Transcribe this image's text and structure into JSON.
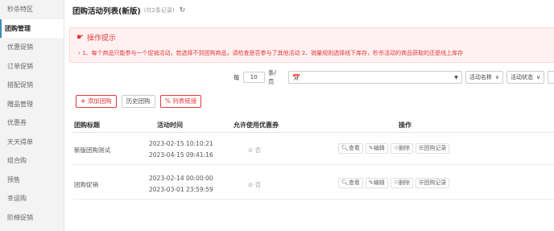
{
  "sidebar": {
    "items": [
      {
        "label": "秒杀特区",
        "active": false
      },
      {
        "label": "团购管理",
        "active": true
      },
      {
        "label": "优惠促销",
        "active": false
      },
      {
        "label": "订单促销",
        "active": false
      },
      {
        "label": "搭配促销",
        "active": false
      },
      {
        "label": "赠品管理",
        "active": false
      },
      {
        "label": "优惠券",
        "active": false
      },
      {
        "label": "天天得单",
        "active": false
      },
      {
        "label": "组合购",
        "active": false
      },
      {
        "label": "预售",
        "active": false
      },
      {
        "label": "幸运购",
        "active": false
      },
      {
        "label": "阶梯促销",
        "active": false
      }
    ]
  },
  "header": {
    "title": "团购活动列表(新版)",
    "count": "(共2条记录)",
    "refresh_icon": "refresh-icon"
  },
  "tip": {
    "title": "操作提示",
    "icon": "hand-icon",
    "text": "1、每个商品只能参与一个促销活动，若选择不到团购商品，请检查是否参与了其他活动 2、销量规则选择线下库存，秒杀活动的商品获取的还是线上库存"
  },
  "filter": {
    "per_prefix": "每",
    "per_value": "10",
    "per_suffix": "条/页",
    "date_placeholder": "",
    "select_name": "活动名称",
    "select_status": "活动状态"
  },
  "toolbar": {
    "add_label": "添加团购",
    "history_label": "历史团购",
    "list_link_label": "列表链接"
  },
  "table": {
    "headers": {
      "name": "团购标题",
      "time": "活动时间",
      "coupon": "允许使用优惠券",
      "ops": "操作"
    },
    "rows": [
      {
        "name": "新版团购测试",
        "start": "2023-02-15 10:10:21",
        "end": "2023-04-15 09:41:16",
        "coupon": "否"
      },
      {
        "name": "团购促销",
        "start": "2023-02-14 00:00:00",
        "end": "2023-03-01 23:59:59",
        "coupon": "否"
      }
    ],
    "ops": {
      "view": "查看",
      "edit": "编辑",
      "delete": "删除",
      "records": "团购记录"
    }
  }
}
